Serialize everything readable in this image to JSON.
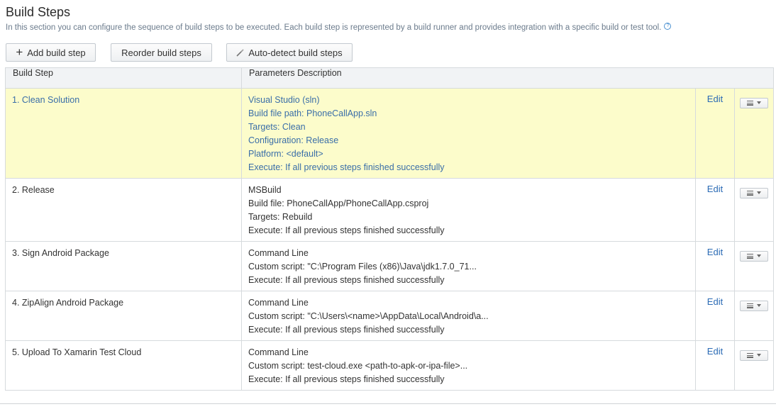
{
  "section": {
    "title": "Build Steps",
    "description": "In this section you can configure the sequence of build steps to be executed. Each build step is represented by a build runner and provides integration with a specific build or test tool."
  },
  "toolbar": {
    "add_label": "Add build step",
    "reorder_label": "Reorder build steps",
    "autodetect_label": "Auto-detect build steps"
  },
  "table": {
    "columns": [
      "Build Step",
      "Parameters Description"
    ],
    "edit_label": "Edit",
    "rows": [
      {
        "step": "1. Clean Solution",
        "highlighted": true,
        "params": [
          "Visual Studio (sln)",
          "Build file path: PhoneCallApp.sln",
          "Targets: Clean",
          "Configuration: Release",
          "Platform: <default>",
          "Execute: If all previous steps finished successfully"
        ]
      },
      {
        "step": "2. Release",
        "highlighted": false,
        "params": [
          "MSBuild",
          "Build file: PhoneCallApp/PhoneCallApp.csproj",
          "Targets: Rebuild",
          "Execute: If all previous steps finished successfully"
        ]
      },
      {
        "step": "3. Sign Android Package",
        "highlighted": false,
        "params": [
          "Command Line",
          "Custom script: \"C:\\Program Files (x86)\\Java\\jdk1.7.0_71...",
          "Execute: If all previous steps finished successfully"
        ]
      },
      {
        "step": "4. ZipAlign Android Package",
        "highlighted": false,
        "params": [
          "Command Line",
          "Custom script: \"C:\\Users\\<name>\\AppData\\Local\\Android\\a...",
          "Execute: If all previous steps finished successfully"
        ]
      },
      {
        "step": "5. Upload To Xamarin Test Cloud",
        "highlighted": false,
        "params": [
          "Command Line",
          "Custom script: test-cloud.exe <path-to-apk-or-ipa-file>...",
          "Execute: If all previous steps finished successfully"
        ]
      }
    ]
  }
}
